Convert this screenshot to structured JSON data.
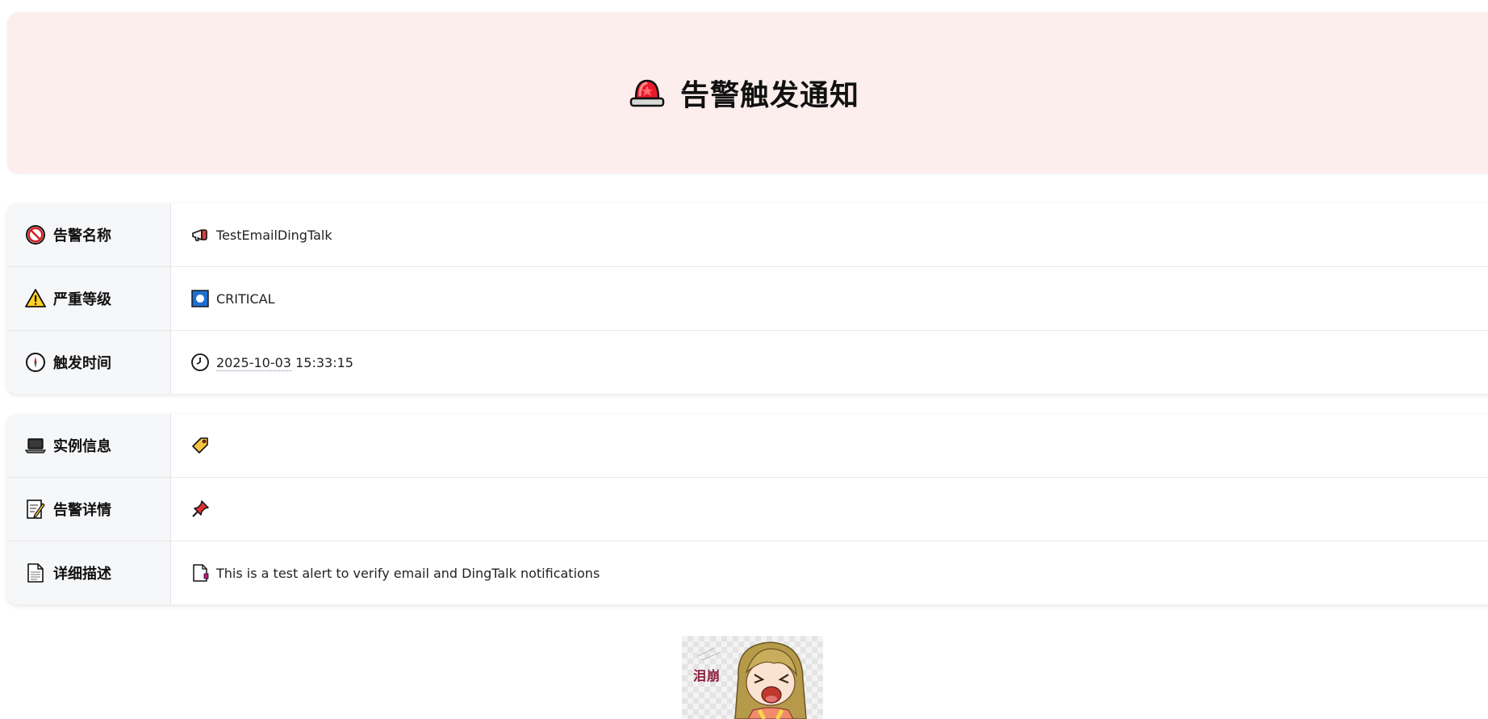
{
  "header": {
    "title": "告警触发通知",
    "icon": "siren-icon",
    "background_color": "#fdeeee"
  },
  "summary_card": {
    "rows": [
      {
        "label": "告警名称",
        "label_icon": "no-entry-icon",
        "value_icon": "megaphone-icon",
        "value": "TestEmailDingTalk"
      },
      {
        "label": "严重等级",
        "label_icon": "warning-icon",
        "value_icon": "blue-square-button-icon",
        "value": "CRITICAL"
      },
      {
        "label": "触发时间",
        "label_icon": "compass-icon",
        "value_icon": "clock-icon",
        "date": "2025-10-03",
        "time": "15:33:15"
      }
    ]
  },
  "detail_card": {
    "rows": [
      {
        "label": "实例信息",
        "label_icon": "laptop-icon",
        "value_icon": "label-tag-icon",
        "value": ""
      },
      {
        "label": "告警详情",
        "label_icon": "memo-icon",
        "value_icon": "pushpin-icon",
        "value": ""
      },
      {
        "label": "详细描述",
        "label_icon": "page-icon",
        "value_icon": "bookmark-page-icon",
        "value": "This is a test alert to verify email and DingTalk notifications"
      }
    ]
  },
  "sticker": {
    "icon": "crying-girl-sticker",
    "text": "泪崩"
  }
}
